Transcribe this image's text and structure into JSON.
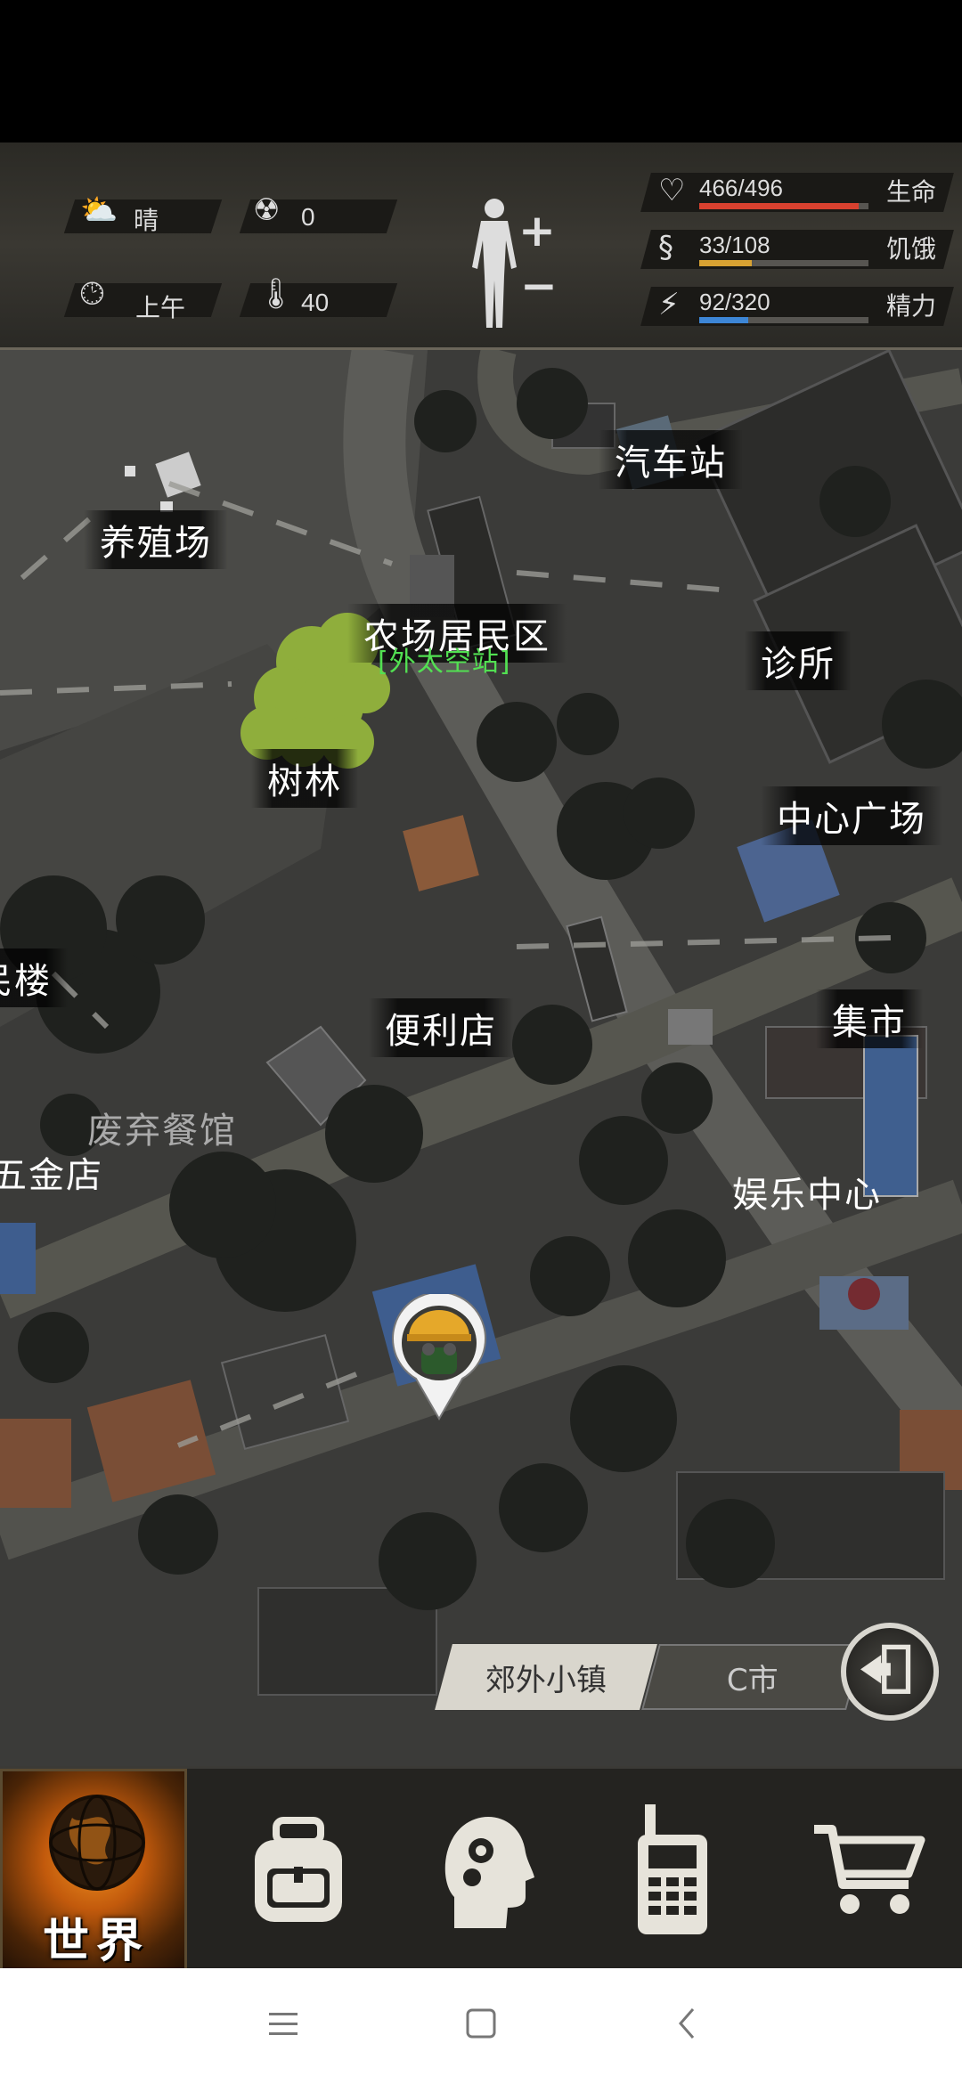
{
  "hud": {
    "weather": {
      "icon": "partly-cloudy-icon",
      "value": "晴"
    },
    "radiation": {
      "icon": "radiation-icon",
      "value": "0"
    },
    "time": {
      "icon": "clock-icon",
      "value": "上午"
    },
    "temperature": {
      "icon": "thermometer-icon",
      "value": "40"
    },
    "stats": [
      {
        "icon": "heart-icon",
        "value": "466/496",
        "label": "生命",
        "fraction": 0.94,
        "color": "#d8412f"
      },
      {
        "icon": "stomach-icon",
        "value": "33/108",
        "label": "饥饿",
        "fraction": 0.31,
        "color": "#d8a232"
      },
      {
        "icon": "energy-icon",
        "value": "92/320",
        "label": "精力",
        "fraction": 0.29,
        "color": "#3d86d6"
      }
    ]
  },
  "map": {
    "locations": {
      "bus_station": "汽车站",
      "farm": "养殖场",
      "farm_residential": "农场居民区",
      "farm_residential_sub": "[外太空站]",
      "clinic": "诊所",
      "woods": "树林",
      "central_square": "中心广场",
      "apartment": "民楼",
      "convenience_store": "便利店",
      "market": "集市",
      "abandoned_restaurant": "废弃餐馆",
      "hardware_store": "五金店",
      "entertainment_center": "娱乐中心"
    }
  },
  "regions": {
    "active": "郊外小镇",
    "other": "C市"
  },
  "nav": {
    "world": "世界",
    "items": [
      "globe-icon",
      "backpack-icon",
      "skills-head-icon",
      "radio-icon",
      "cart-icon"
    ]
  }
}
